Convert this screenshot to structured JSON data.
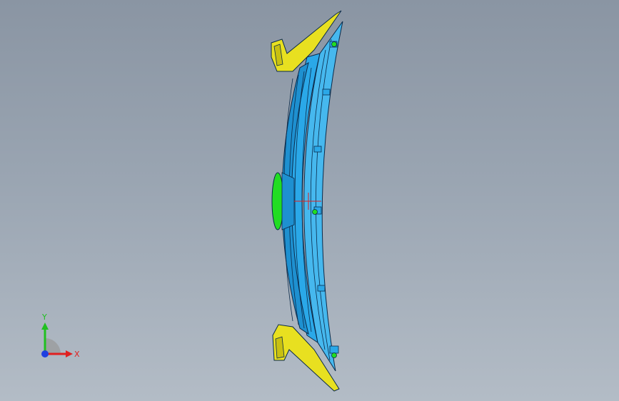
{
  "viewport": {
    "background_top": "#8a95a3",
    "background_bottom": "#b3bcc6"
  },
  "model": {
    "body_color": "#2aa8e8",
    "bracket_color": "#e8e020",
    "highlight_color": "#22dd22",
    "edge_color": "#0a2a4a"
  },
  "triad": {
    "x_label": "X",
    "y_label": "Y",
    "x_color": "#e02020",
    "y_color": "#20c020",
    "z_color": "#2040e0"
  }
}
